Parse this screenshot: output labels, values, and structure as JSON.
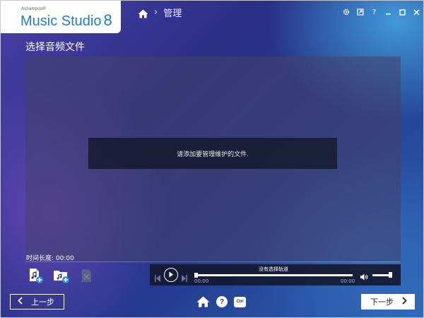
{
  "app": {
    "vendor": "Ashampoo®",
    "name": "Music Studio",
    "version": "8"
  },
  "nav": {
    "breadcrumb_sep": "›",
    "breadcrumb_current": "管理"
  },
  "window_controls": [
    "gear-icon",
    "export-icon",
    "help-icon",
    "minimize-icon",
    "maximize-icon",
    "close-icon"
  ],
  "window_controls_glyphs": {
    "help": "?"
  },
  "page": {
    "title": "选择音频文件",
    "empty_message": "请添加要管理维护的文件.",
    "duration_label": "时间长度: 00:00"
  },
  "player": {
    "track_label": "没有选择轨道",
    "time_start": "00:00",
    "time_end": "00:00",
    "progress": 0,
    "volume": 0.85
  },
  "footer": {
    "prev_label": "上一步",
    "next_label": "下一步",
    "help_glyph": "?",
    "ctrl_label": "Ctrl"
  },
  "colors": {
    "brand": "#1b7fd0",
    "panel": "#464169",
    "message_bg": "#181c34",
    "accent_blue": "#3a8fe0"
  }
}
